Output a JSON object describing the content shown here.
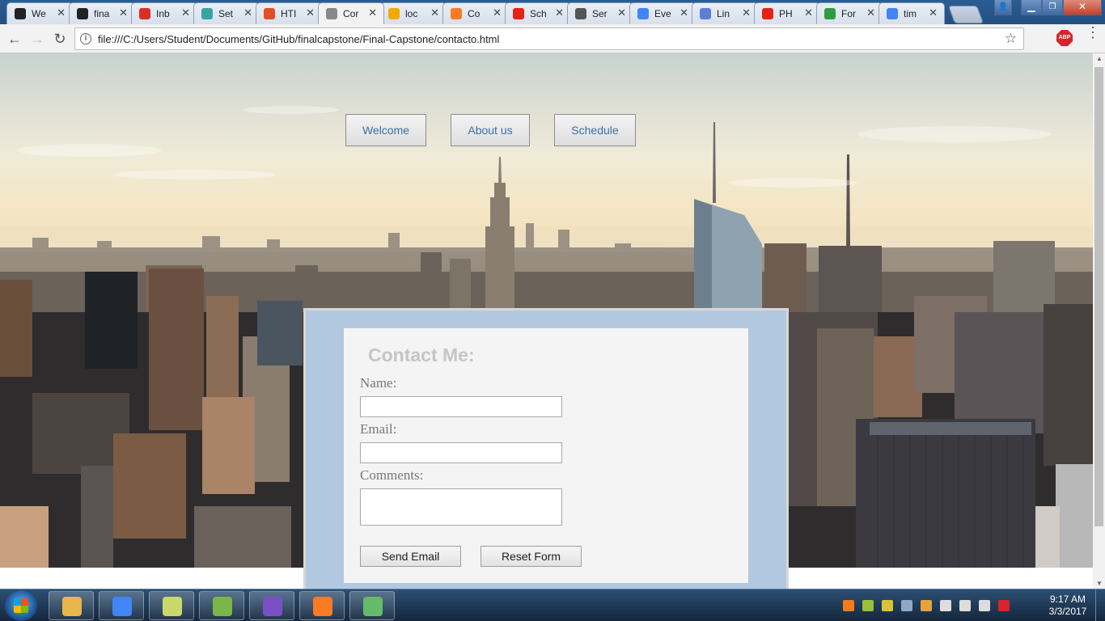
{
  "browser": {
    "tabs": [
      {
        "label": "We",
        "icon": "github-icon",
        "color": "#222222"
      },
      {
        "label": "fina",
        "icon": "github-icon",
        "color": "#222222"
      },
      {
        "label": "Inb",
        "icon": "gmail-icon",
        "color": "#d93025"
      },
      {
        "label": "Set",
        "icon": "grid-icon",
        "color": "#3aa3a3"
      },
      {
        "label": "HTI",
        "icon": "html5-icon",
        "color": "#e44d26"
      },
      {
        "label": "Cor",
        "icon": "page-icon",
        "color": "#888888"
      },
      {
        "label": "loc",
        "icon": "phpmyadmin-icon",
        "color": "#f2a900"
      },
      {
        "label": "Co",
        "icon": "xampp-icon",
        "color": "#fb7a24"
      },
      {
        "label": "Sch",
        "icon": "youtube-icon",
        "color": "#e62117"
      },
      {
        "label": "Ser",
        "icon": "globe-icon",
        "color": "#555555"
      },
      {
        "label": "Eve",
        "icon": "google-icon",
        "color": "#4285f4"
      },
      {
        "label": "Lin",
        "icon": "circle-icon",
        "color": "#5b7fd4"
      },
      {
        "label": "PH",
        "icon": "youtube-icon",
        "color": "#e62117"
      },
      {
        "label": "For",
        "icon": "brazil-flag-icon",
        "color": "#2e9c3f"
      },
      {
        "label": "tim",
        "icon": "google-icon",
        "color": "#4285f4"
      }
    ],
    "active_tab_index": 5,
    "url": "file:///C:/Users/Student/Documents/GitHub/finalcapstone/Final-Capstone/contacto.html",
    "extension_label": "ABP",
    "close_symbol": "✕",
    "back_symbol": "←",
    "forward_symbol": "→",
    "reload_symbol": "↻",
    "star_symbol": "☆",
    "info_symbol": "i",
    "menu_symbol": "⋮",
    "min_symbol": "▁",
    "max_symbol": "❐",
    "scroll_up_symbol": "▲",
    "scroll_down_symbol": "▼"
  },
  "page": {
    "nav": [
      {
        "label": "Welcome"
      },
      {
        "label": "About us"
      },
      {
        "label": "Schedule"
      }
    ],
    "contact": {
      "title": "Contact Me:",
      "name_label": "Name:",
      "email_label": "Email:",
      "comments_label": "Comments:",
      "name_value": "",
      "email_value": "",
      "comments_value": "",
      "send_label": "Send Email",
      "reset_label": "Reset Form"
    },
    "colors": {
      "form_panel": "#b2c8e0",
      "link_text": "#3a6ea5",
      "title_text": "#c5c5c5"
    }
  },
  "taskbar": {
    "apps": [
      {
        "name": "file-explorer-icon",
        "color": "#e8b64a"
      },
      {
        "name": "chrome-icon",
        "color": "#4285f4"
      },
      {
        "name": "snip-icon",
        "color": "#c8d86a"
      },
      {
        "name": "notepadpp-icon",
        "color": "#7ab648"
      },
      {
        "name": "github-desktop-icon",
        "color": "#7a4fc4"
      },
      {
        "name": "xampp-icon",
        "color": "#fb7a24"
      },
      {
        "name": "atom-icon",
        "color": "#66bb6a"
      }
    ],
    "tray": [
      {
        "name": "xampp-tray-icon",
        "color": "#f07c1c"
      },
      {
        "name": "tray-globe-icon",
        "color": "#9bbf3a"
      },
      {
        "name": "tray-key-icon",
        "color": "#d8c23a"
      },
      {
        "name": "tray-network-icon",
        "color": "#8fa8c8"
      },
      {
        "name": "tray-flag-icon",
        "color": "#e6a23c"
      },
      {
        "name": "tray-battery-icon",
        "color": "#dddddd"
      },
      {
        "name": "tray-volume-icon",
        "color": "#dddddd"
      },
      {
        "name": "tray-signal-icon",
        "color": "#dddddd"
      },
      {
        "name": "tray-alert-icon",
        "color": "#d9232a"
      }
    ],
    "time": "9:17 AM",
    "date": "3/3/2017"
  }
}
